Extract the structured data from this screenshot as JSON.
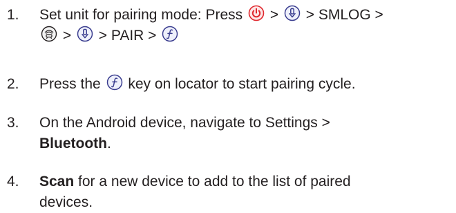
{
  "steps": [
    {
      "number": "1.",
      "line1": {
        "prefix": "Set unit for pairing mode: Press ",
        "sep1": " > ",
        "sep2": " > ",
        "suffix": "SMLOG >"
      },
      "line2": {
        "sep1": " > ",
        "sep2": " > PAIR > "
      }
    },
    {
      "number": "2.",
      "prefix": "Press the ",
      "suffix": " key on locator to start pairing cycle."
    },
    {
      "number": "3.",
      "line1": "On the Android device, navigate to Settings >",
      "line2_bold": "Bluetooth",
      "line2_end": "."
    },
    {
      "number": "4.",
      "bold": "Scan",
      "line1_rest": " for a new device to add to the list of paired",
      "line2": "devices."
    }
  ],
  "icons": {
    "power": "power-icon",
    "down": "down-arrow-key-icon",
    "sonde": "sonde-mode-icon",
    "function": "function-key-icon"
  },
  "colors": {
    "text": "#231f20",
    "power_red": "#e0282e",
    "key_blue": "#3a3d8f"
  }
}
